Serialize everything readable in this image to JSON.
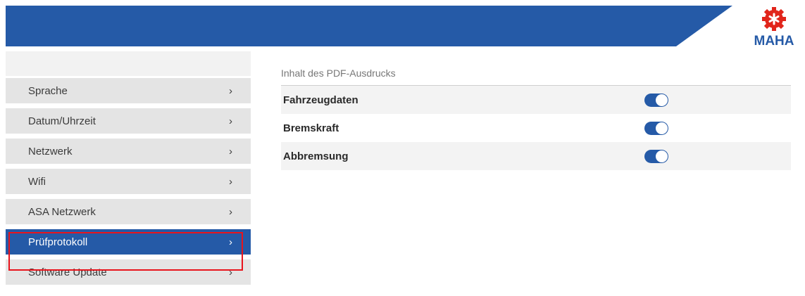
{
  "header": {
    "brand": "MAHA",
    "colors": {
      "bar": "#255aa7",
      "logo_red": "#e1251b",
      "logo_blue": "#255aa7"
    }
  },
  "sidebar": {
    "items": [
      {
        "label": "Sprache",
        "chevron": "›",
        "active": false
      },
      {
        "label": "Datum/Uhrzeit",
        "chevron": "›",
        "active": false
      },
      {
        "label": "Netzwerk",
        "chevron": "›",
        "active": false
      },
      {
        "label": "Wifi",
        "chevron": "›",
        "active": false
      },
      {
        "label": "ASA Netzwerk",
        "chevron": "›",
        "active": false
      },
      {
        "label": "Prüfprotokoll",
        "chevron": "›",
        "active": true
      },
      {
        "label": "Software Update",
        "chevron": "›",
        "active": false
      }
    ],
    "highlight_color": "#e8141c"
  },
  "main": {
    "section_title": "Inhalt des PDF-Ausdrucks",
    "options": [
      {
        "label": "Fahrzeugdaten",
        "enabled": true
      },
      {
        "label": "Bremskraft",
        "enabled": true
      },
      {
        "label": "Abbremsung",
        "enabled": true
      }
    ],
    "accent_color": "#255aa7"
  }
}
